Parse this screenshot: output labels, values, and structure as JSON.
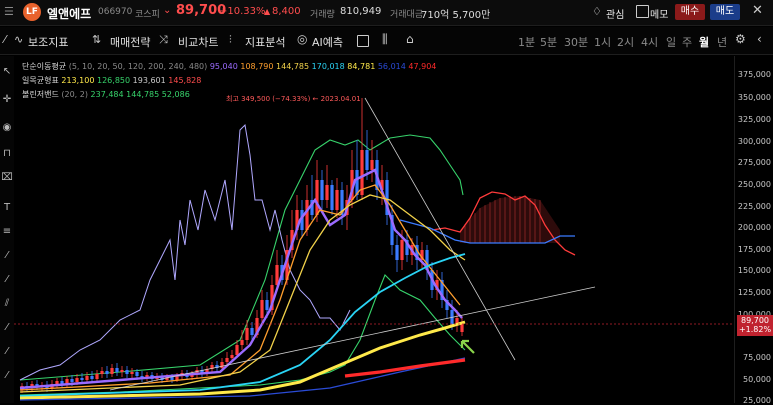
{
  "header": {
    "logo_text": "LF",
    "stock_name": "엘앤에프",
    "code": "066970",
    "market": "코스피",
    "price": "89,700",
    "change_pct": "+10.33%",
    "change_arrow": "▲",
    "change_amt": "8,400",
    "volume_label": "거래량",
    "volume": "810,949",
    "value_label": "거래대금",
    "value": "710억 5,700만",
    "watch_label": "관심",
    "memo_label": "메모",
    "buy_label": "매수",
    "sell_label": "매도"
  },
  "toolbar": {
    "indicator_label": "보조지표",
    "strategy_label": "매매전략",
    "compare_label": "비교차트",
    "analysis_label": "지표분석",
    "ai_label": "AI예측",
    "timeframes": [
      "1분",
      "5분",
      "30분",
      "1시",
      "2시",
      "4시",
      "일",
      "주",
      "월",
      "년"
    ],
    "active_timeframe": "월"
  },
  "legend": {
    "sma_label": "단순이동평균",
    "sma_params": "(5, 10, 20, 50, 120, 200, 240, 480)",
    "sma_values": [
      {
        "v": "95,040",
        "color": "#9b6bff"
      },
      {
        "v": "108,790",
        "color": "#ff9f2e"
      },
      {
        "v": "144,785",
        "color": "#f2d24a"
      },
      {
        "v": "170,018",
        "color": "#2ad4f5"
      },
      {
        "v": "84,781",
        "color": "#ffe94a"
      },
      {
        "v": "56,014",
        "color": "#2a4bd6"
      },
      {
        "v": "47,904",
        "color": "#ff2a2a"
      }
    ],
    "ichimoku_label": "일목균형표",
    "ichimoku_values": [
      {
        "v": "213,100",
        "color": "#ffe94a"
      },
      {
        "v": "126,850",
        "color": "#37d36b"
      },
      {
        "v": "193,601",
        "color": "#c8c8c8"
      },
      {
        "v": "145,828",
        "color": "#ff4d4d"
      }
    ],
    "bollinger_label": "볼린저밴드",
    "bollinger_params": "(20, 2)",
    "bollinger_values": [
      {
        "v": "237,484",
        "color": "#37d36b"
      },
      {
        "v": "144,785",
        "color": "#37d36b"
      },
      {
        "v": "52,086",
        "color": "#37d36b"
      }
    ]
  },
  "annotation": {
    "high_label": "최고 349,500 (−74.33%) ← 2023.04.01"
  },
  "y_axis": {
    "ticks": [
      "375,000",
      "350,000",
      "325,000",
      "300,000",
      "275,000",
      "250,000",
      "225,000",
      "200,000",
      "175,000",
      "150,000",
      "125,000",
      "100,000",
      "75,000",
      "50,000",
      "25,000"
    ],
    "current_price": "89,700",
    "current_pct": "+1.82%"
  },
  "colors": {
    "up": "#ff3b3b",
    "down": "#3b7bff",
    "background": "#000000"
  }
}
